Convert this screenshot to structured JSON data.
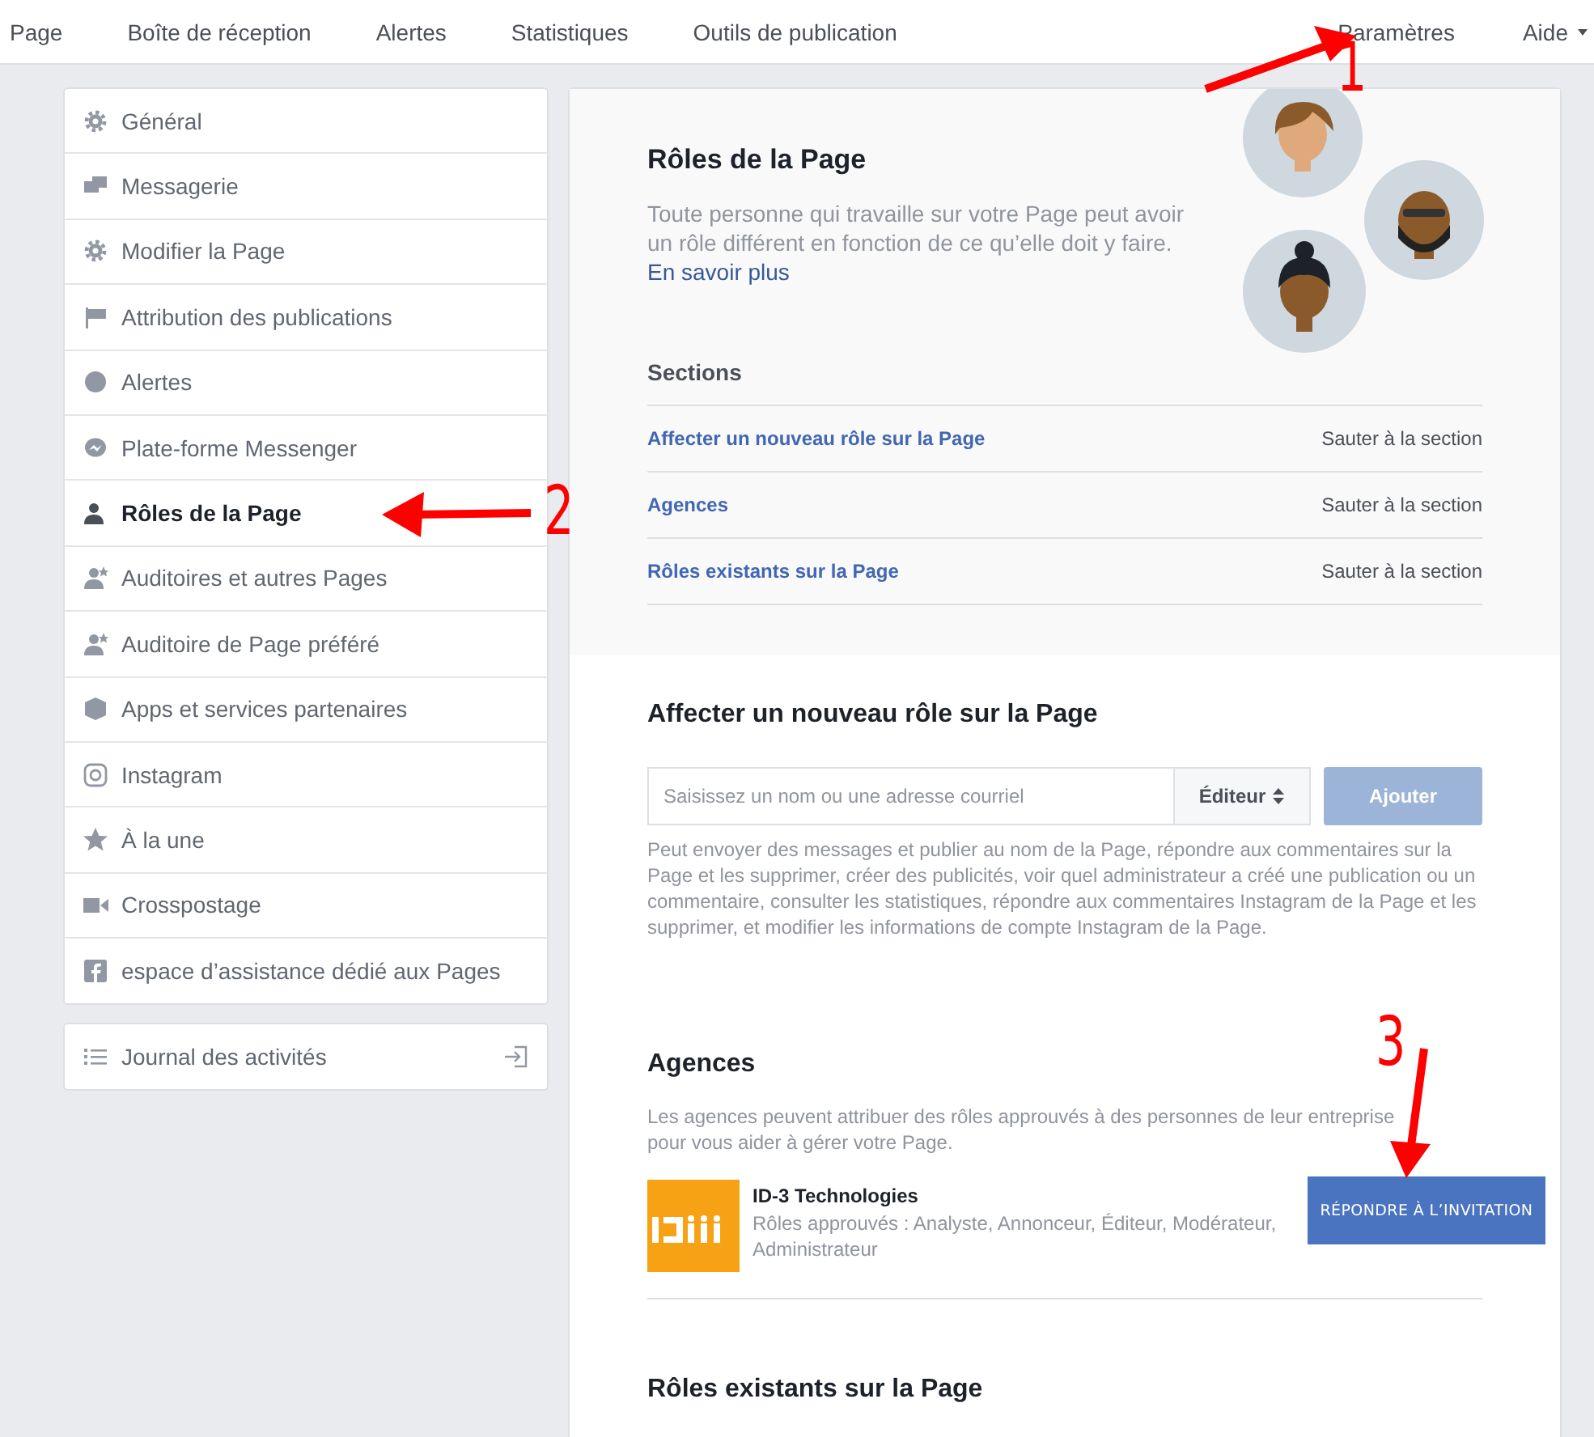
{
  "top_nav": {
    "items": [
      {
        "label": "Page",
        "dropdown": false
      },
      {
        "label": "Boîte de réception",
        "dropdown": false
      },
      {
        "label": "Alertes",
        "dropdown": false
      },
      {
        "label": "Statistiques",
        "dropdown": false
      },
      {
        "label": "Outils de publication",
        "dropdown": false
      }
    ],
    "right_items": [
      {
        "label": "Paramètres",
        "dropdown": false
      },
      {
        "label": "Aide",
        "dropdown": true
      }
    ]
  },
  "sidebar": {
    "items": [
      {
        "label": "Général",
        "selected": false
      },
      {
        "label": "Messagerie",
        "selected": false
      },
      {
        "label": "Modifier la Page",
        "selected": false
      },
      {
        "label": "Attribution des publications",
        "selected": false
      },
      {
        "label": "Alertes",
        "selected": false
      },
      {
        "label": "Plate-forme Messenger",
        "selected": false
      },
      {
        "label": "Rôles de la Page",
        "selected": true
      },
      {
        "label": "Auditoires et autres Pages",
        "selected": false
      },
      {
        "label": "Auditoire de Page préféré",
        "selected": false
      },
      {
        "label": "Apps et services partenaires",
        "selected": false
      },
      {
        "label": "Instagram",
        "selected": false
      },
      {
        "label": "À la une",
        "selected": false
      },
      {
        "label": "Crosspostage",
        "selected": false
      },
      {
        "label": "espace d’assistance dédié aux Pages",
        "selected": false
      }
    ],
    "footer_item": {
      "label": "Journal des activités"
    }
  },
  "intro": {
    "title": "Rôles de la Page",
    "description": "Toute personne qui travaille sur votre Page peut avoir un rôle différent en fonction de ce qu’elle doit y faire.",
    "link": "En savoir plus"
  },
  "sections": {
    "heading": "Sections",
    "rows": [
      {
        "label": "Affecter un nouveau rôle sur la Page",
        "jump": "Sauter à la section"
      },
      {
        "label": "Agences",
        "jump": "Sauter à la section"
      },
      {
        "label": "Rôles existants sur la Page",
        "jump": "Sauter à la section"
      }
    ]
  },
  "assign": {
    "title": "Affecter un nouveau rôle sur la Page",
    "placeholder": "Saisissez un nom ou une adresse courriel",
    "role": "Éditeur",
    "button": {
      "label": "Ajouter",
      "disabled": true
    },
    "description": "Peut envoyer des messages et publier au nom de la Page, répondre aux commentaires sur la Page et les supprimer, créer des publicités, voir quel administrateur a créé une publication ou un commentaire, consulter les statistiques, répondre aux commentaires Instagram de la Page et les supprimer, et modifier les informations de compte Instagram de la Page."
  },
  "agencies": {
    "title": "Agences",
    "description": "Les agences peuvent attribuer des rôles approuvés à des personnes de leur entreprise pour vous aider à gérer votre Page.",
    "agency": {
      "name": "ID-3 Technologies",
      "roles": "Rôles approuvés : Analyste, Annonceur, Éditeur, Modérateur, Administrateur",
      "button": "RÉPONDRE À L’INVITATION"
    }
  },
  "existing": {
    "title": "Rôles existants sur la Page"
  },
  "annotations": [
    {
      "label": "1"
    },
    {
      "label": "2"
    },
    {
      "label": "3"
    }
  ]
}
